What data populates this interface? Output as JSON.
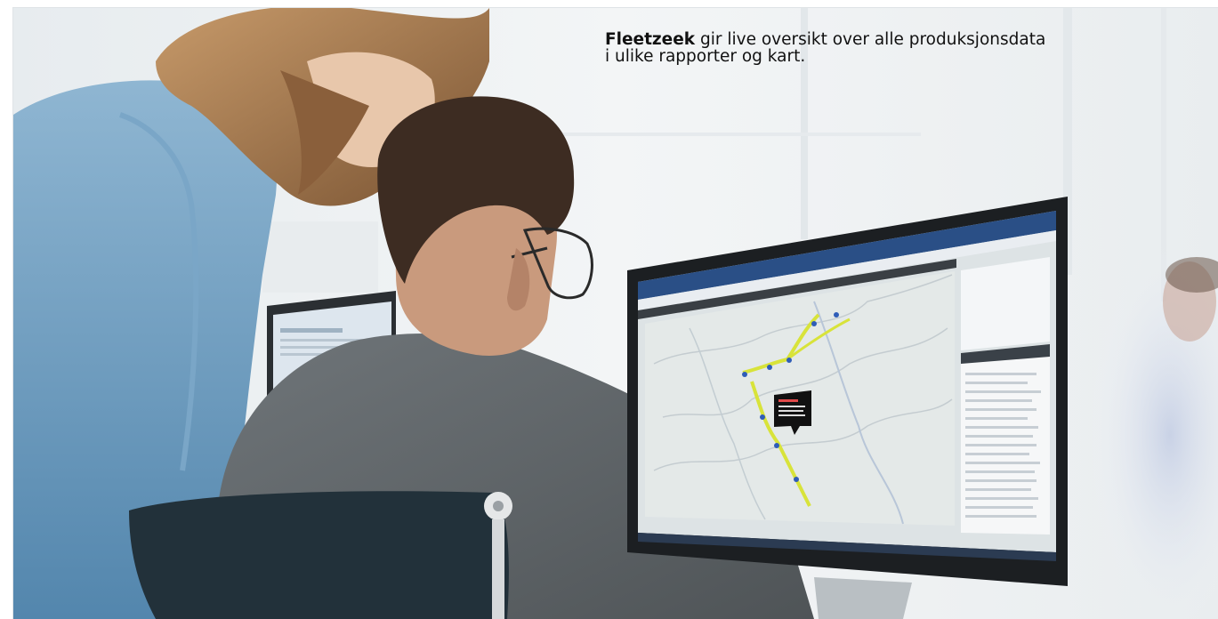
{
  "caption": {
    "brand": "Fleetzeek",
    "line1_rest": " gir live oversikt over alle produksjonsdata",
    "line2": "i ulike rapporter og  kart."
  },
  "colors": {
    "screen_bezel": "#1c1f22",
    "map_background": "#dde3e5",
    "route_color": "#d8e33a",
    "shirt_woman": "#6c9dc2",
    "sweater_man": "#5e6468",
    "chair": "#22313a"
  },
  "scene_objects": [
    "office-background",
    "colleague-woman",
    "man-with-glasses",
    "desk-monitor",
    "map-application",
    "office-chair",
    "blurred-person"
  ]
}
